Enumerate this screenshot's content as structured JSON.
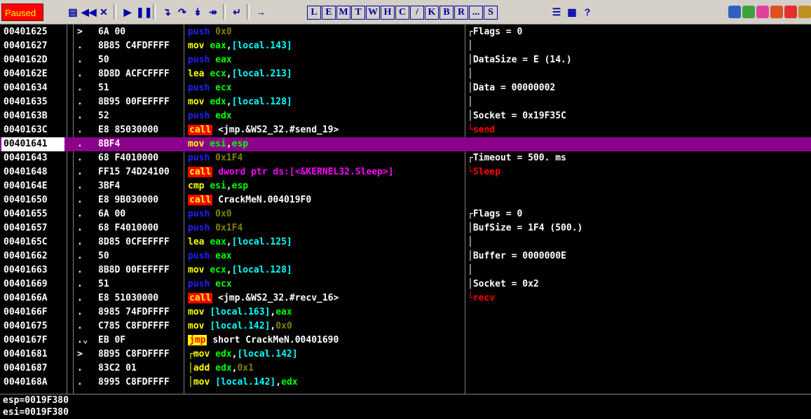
{
  "status": "Paused",
  "colors": {
    "status_bg": "#ff0000",
    "status_fg": "#ffff00",
    "selection": "#8b008b",
    "toolbar_bg": "#d4d0c8"
  },
  "toolbar": {
    "icons": [
      {
        "name": "open-file-icon",
        "glyph": "▤"
      },
      {
        "name": "rewind-icon",
        "glyph": "◀◀"
      },
      {
        "name": "close-icon",
        "glyph": "✕"
      },
      {
        "name": "run-icon",
        "glyph": "▶"
      },
      {
        "name": "pause-icon",
        "glyph": "❚❚"
      },
      {
        "name": "step-into-icon",
        "glyph": "↴"
      },
      {
        "name": "step-over-icon",
        "glyph": "↷"
      },
      {
        "name": "trace-into-icon",
        "glyph": "↡"
      },
      {
        "name": "trace-over-icon",
        "glyph": "↠"
      },
      {
        "name": "execute-till-return-icon",
        "glyph": "↵"
      },
      {
        "name": "go-to-icon",
        "glyph": "→"
      }
    ],
    "letters": [
      "L",
      "E",
      "M",
      "T",
      "W",
      "H",
      "C",
      "/",
      "K",
      "B",
      "R",
      "...",
      "S"
    ],
    "right_icons": [
      {
        "name": "list-icon",
        "glyph": "☰"
      },
      {
        "name": "grid-icon",
        "glyph": "▦"
      },
      {
        "name": "help-icon",
        "glyph": "?"
      }
    ],
    "plugin_icons": [
      {
        "name": "plugin-blue-icon",
        "color": "#3060c0"
      },
      {
        "name": "plugin-green-icon",
        "color": "#40a040"
      },
      {
        "name": "plugin-pink-icon",
        "color": "#e040a0"
      },
      {
        "name": "plugin-red-icon",
        "color": "#e05020"
      },
      {
        "name": "plugin-target-icon",
        "color": "#e03030"
      },
      {
        "name": "plugin-binary-icon",
        "color": "#c09020"
      }
    ]
  },
  "rows": [
    {
      "addr": "00401625",
      "arrow": ">",
      "hex": "6A 00",
      "mn": "push",
      "mnc": "push",
      "ops": [
        {
          "t": "0x0",
          "c": "imm"
        }
      ],
      "cmt": "┌Flags = 0",
      "cmtc": ""
    },
    {
      "addr": "00401627",
      "arrow": ".",
      "hex": "8B85 C4FDFFFF",
      "mn": "mov",
      "mnc": "mov",
      "ops": [
        {
          "t": "eax",
          "c": "reg"
        },
        {
          "t": ",",
          "c": ""
        },
        {
          "t": "[local.143]",
          "c": "mem"
        }
      ],
      "cmt": "│",
      "cmtc": ""
    },
    {
      "addr": "0040162D",
      "arrow": ".",
      "hex": "50",
      "mn": "push",
      "mnc": "push",
      "ops": [
        {
          "t": "eax",
          "c": "reg"
        }
      ],
      "cmt": "│DataSize = E (14.)",
      "cmtc": ""
    },
    {
      "addr": "0040162E",
      "arrow": ".",
      "hex": "8D8D ACFCFFFF",
      "mn": "lea",
      "mnc": "lea",
      "ops": [
        {
          "t": "ecx",
          "c": "reg"
        },
        {
          "t": ",",
          "c": ""
        },
        {
          "t": "[local.213]",
          "c": "mem"
        }
      ],
      "cmt": "│",
      "cmtc": ""
    },
    {
      "addr": "00401634",
      "arrow": ".",
      "hex": "51",
      "mn": "push",
      "mnc": "push",
      "ops": [
        {
          "t": "ecx",
          "c": "reg"
        }
      ],
      "cmt": "│Data = 00000002",
      "cmtc": ""
    },
    {
      "addr": "00401635",
      "arrow": ".",
      "hex": "8B95 00FEFFFF",
      "mn": "mov",
      "mnc": "mov",
      "ops": [
        {
          "t": "edx",
          "c": "reg"
        },
        {
          "t": ",",
          "c": ""
        },
        {
          "t": "[local.128]",
          "c": "mem"
        }
      ],
      "cmt": "│",
      "cmtc": ""
    },
    {
      "addr": "0040163B",
      "arrow": ".",
      "hex": "52",
      "mn": "push",
      "mnc": "push",
      "ops": [
        {
          "t": "edx",
          "c": "reg"
        }
      ],
      "cmt": "│Socket = 0x19F35C",
      "cmtc": ""
    },
    {
      "addr": "0040163C",
      "arrow": ".",
      "hex": "E8 85030000",
      "mn": "call",
      "mnc": "call",
      "ops": [
        {
          "t": "<jmp.&WS2_32.#send_19>",
          "c": ""
        }
      ],
      "cmt": "└send",
      "cmtc": "red"
    },
    {
      "addr": "00401641",
      "arrow": ".",
      "hex": "8BF4",
      "mn": "mov",
      "mnc": "mov",
      "ops": [
        {
          "t": "esi",
          "c": "reg"
        },
        {
          "t": ",",
          "c": ""
        },
        {
          "t": "esp",
          "c": "reg"
        }
      ],
      "cmt": "",
      "cmtc": "",
      "sel": true
    },
    {
      "addr": "00401643",
      "arrow": ".",
      "hex": "68 F4010000",
      "mn": "push",
      "mnc": "push",
      "ops": [
        {
          "t": "0x1F4",
          "c": "imm"
        }
      ],
      "cmt": "┌Timeout = 500. ms",
      "cmtc": ""
    },
    {
      "addr": "00401648",
      "arrow": ".",
      "hex": "FF15 74D24100",
      "mn": "call",
      "mnc": "call",
      "ops": [
        {
          "t": "dword ptr ds:[<&KERNEL32.Sleep>]",
          "c": "red"
        }
      ],
      "cmt": "└Sleep",
      "cmtc": "red"
    },
    {
      "addr": "0040164E",
      "arrow": ".",
      "hex": "3BF4",
      "mn": "cmp",
      "mnc": "cmp",
      "ops": [
        {
          "t": "esi",
          "c": "reg"
        },
        {
          "t": ",",
          "c": ""
        },
        {
          "t": "esp",
          "c": "reg"
        }
      ],
      "cmt": "",
      "cmtc": ""
    },
    {
      "addr": "00401650",
      "arrow": ".",
      "hex": "E8 9B030000",
      "mn": "call",
      "mnc": "call",
      "ops": [
        {
          "t": "CrackMeN.004019F0",
          "c": ""
        }
      ],
      "cmt": "",
      "cmtc": ""
    },
    {
      "addr": "00401655",
      "arrow": ".",
      "hex": "6A 00",
      "mn": "push",
      "mnc": "push",
      "ops": [
        {
          "t": "0x0",
          "c": "imm"
        }
      ],
      "cmt": "┌Flags = 0",
      "cmtc": ""
    },
    {
      "addr": "00401657",
      "arrow": ".",
      "hex": "68 F4010000",
      "mn": "push",
      "mnc": "push",
      "ops": [
        {
          "t": "0x1F4",
          "c": "imm"
        }
      ],
      "cmt": "│BufSize = 1F4 (500.)",
      "cmtc": ""
    },
    {
      "addr": "0040165C",
      "arrow": ".",
      "hex": "8D85 0CFEFFFF",
      "mn": "lea",
      "mnc": "lea",
      "ops": [
        {
          "t": "eax",
          "c": "reg"
        },
        {
          "t": ",",
          "c": ""
        },
        {
          "t": "[local.125]",
          "c": "mem"
        }
      ],
      "cmt": "│",
      "cmtc": ""
    },
    {
      "addr": "00401662",
      "arrow": ".",
      "hex": "50",
      "mn": "push",
      "mnc": "push",
      "ops": [
        {
          "t": "eax",
          "c": "reg"
        }
      ],
      "cmt": "│Buffer = 0000000E",
      "cmtc": ""
    },
    {
      "addr": "00401663",
      "arrow": ".",
      "hex": "8B8D 00FEFFFF",
      "mn": "mov",
      "mnc": "mov",
      "ops": [
        {
          "t": "ecx",
          "c": "reg"
        },
        {
          "t": ",",
          "c": ""
        },
        {
          "t": "[local.128]",
          "c": "mem"
        }
      ],
      "cmt": "│",
      "cmtc": ""
    },
    {
      "addr": "00401669",
      "arrow": ".",
      "hex": "51",
      "mn": "push",
      "mnc": "push",
      "ops": [
        {
          "t": "ecx",
          "c": "reg"
        }
      ],
      "cmt": "│Socket = 0x2",
      "cmtc": ""
    },
    {
      "addr": "0040166A",
      "arrow": ".",
      "hex": "E8 51030000",
      "mn": "call",
      "mnc": "call",
      "ops": [
        {
          "t": "<jmp.&WS2_32.#recv_16>",
          "c": ""
        }
      ],
      "cmt": "└recv",
      "cmtc": "red"
    },
    {
      "addr": "0040166F",
      "arrow": ".",
      "hex": "8985 74FDFFFF",
      "mn": "mov",
      "mnc": "mov",
      "ops": [
        {
          "t": "[local.163]",
          "c": "mem"
        },
        {
          "t": ",",
          "c": ""
        },
        {
          "t": "eax",
          "c": "reg"
        }
      ],
      "cmt": "",
      "cmtc": ""
    },
    {
      "addr": "00401675",
      "arrow": ".",
      "hex": "C785 C8FDFFFF",
      "mn": "mov",
      "mnc": "mov",
      "ops": [
        {
          "t": "[local.142]",
          "c": "mem"
        },
        {
          "t": ",",
          "c": ""
        },
        {
          "t": "0x0",
          "c": "imm"
        }
      ],
      "cmt": "",
      "cmtc": ""
    },
    {
      "addr": "0040167F",
      "arrow": ".⌄",
      "hex": "EB 0F",
      "mn": "jmp",
      "mnc": "jmp",
      "ops": [
        {
          "t": "short CrackMeN.00401690",
          "c": ""
        }
      ],
      "cmt": "",
      "cmtc": ""
    },
    {
      "addr": "00401681",
      "arrow": ">",
      "hex": "8B95 C8FDFFFF",
      "mn": "┌mov",
      "mnc": "mov",
      "ops": [
        {
          "t": "edx",
          "c": "reg"
        },
        {
          "t": ",",
          "c": ""
        },
        {
          "t": "[local.142]",
          "c": "mem"
        }
      ],
      "cmt": "",
      "cmtc": ""
    },
    {
      "addr": "00401687",
      "arrow": ".",
      "hex": "83C2 01",
      "mn": "│add",
      "mnc": "add",
      "ops": [
        {
          "t": "edx",
          "c": "reg"
        },
        {
          "t": ",",
          "c": ""
        },
        {
          "t": "0x1",
          "c": "imm"
        }
      ],
      "cmt": "",
      "cmtc": ""
    },
    {
      "addr": "0040168A",
      "arrow": ".",
      "hex": "8995 C8FDFFFF",
      "mn": "│mov",
      "mnc": "mov",
      "ops": [
        {
          "t": "[local.142]",
          "c": "mem"
        },
        {
          "t": ",",
          "c": ""
        },
        {
          "t": "edx",
          "c": "reg"
        }
      ],
      "cmt": "",
      "cmtc": ""
    }
  ],
  "info": [
    "esp=0019F380",
    "esi=0019F380"
  ]
}
